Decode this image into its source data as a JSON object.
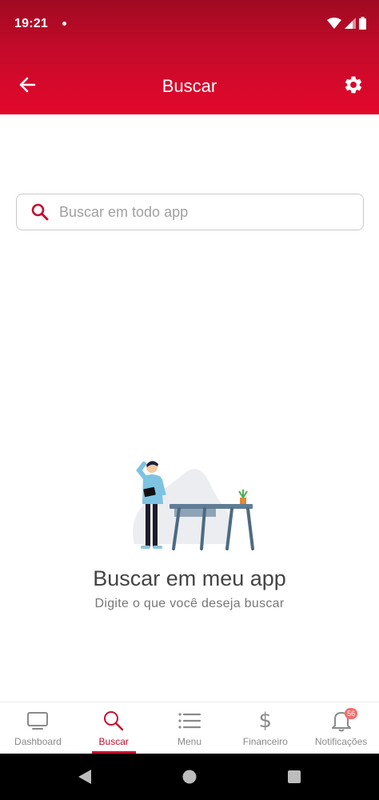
{
  "status_bar": {
    "time": "19:21"
  },
  "header": {
    "title": "Buscar"
  },
  "search": {
    "placeholder": "Buscar em todo app",
    "value": ""
  },
  "empty_state": {
    "title": "Buscar em meu app",
    "subtitle": "Digite o que você deseja buscar"
  },
  "bottom_nav": {
    "items": [
      {
        "label": "Dashboard",
        "icon": "monitor-icon"
      },
      {
        "label": "Buscar",
        "icon": "search-icon",
        "active": true
      },
      {
        "label": "Menu",
        "icon": "list-icon"
      },
      {
        "label": "Financeiro",
        "icon": "dollar-icon"
      },
      {
        "label": "Notificações",
        "icon": "bell-icon",
        "badge": "56"
      }
    ]
  },
  "colors": {
    "brand": "#e4082c",
    "brand_dark": "#a00a22",
    "active": "#c4102f",
    "inactive": "#8a8a8a"
  }
}
